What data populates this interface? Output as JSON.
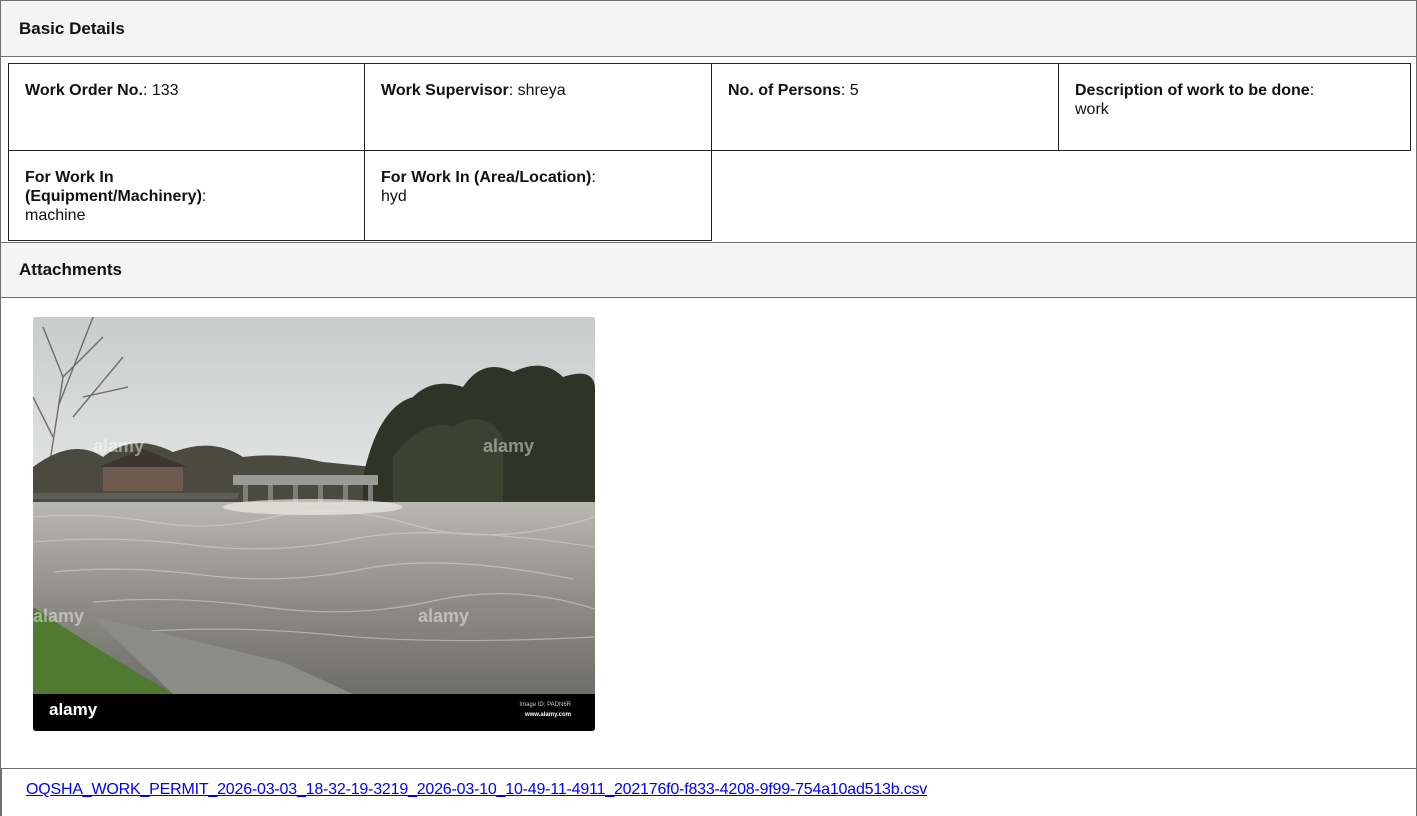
{
  "basic_details": {
    "heading": "Basic Details",
    "work_order_no": {
      "label": "Work Order No.",
      "value": "133"
    },
    "work_supervisor": {
      "label": "Work Supervisor",
      "value": "shreya"
    },
    "no_of_persons": {
      "label": "No. of Persons",
      "value": "5"
    },
    "description": {
      "label": "Description of work to be done",
      "value": "work"
    },
    "equipment": {
      "label_line1": "For Work In",
      "label_line2": "(Equipment/Machinery)",
      "value": "machine"
    },
    "area_location": {
      "label": "For Work In (Area/Location)",
      "value": "hyd"
    }
  },
  "attachments": {
    "heading": "Attachments",
    "photo": {
      "watermark": "alamy",
      "image_id_text": "Image ID: PADN6R",
      "site_text": "www.alamy.com"
    },
    "file_link": "OQSHA_WORK_PERMIT_2026-03-03_18-32-19-3219_2026-03-10_10-49-11-4911_202176f0-f833-4208-9f99-754a10ad513b.csv"
  }
}
